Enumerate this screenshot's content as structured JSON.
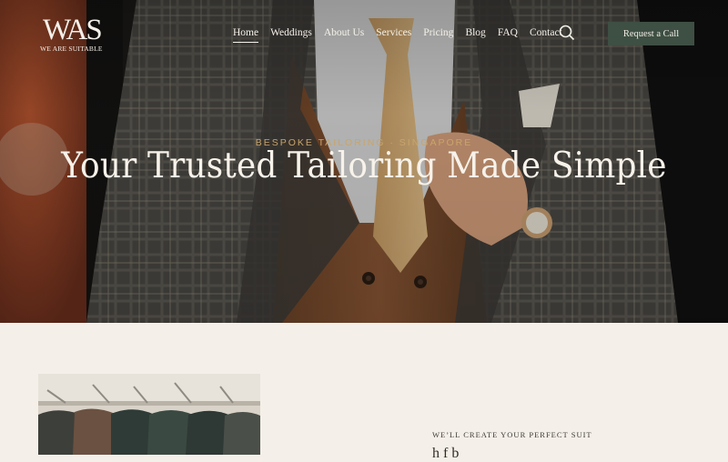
{
  "brand": {
    "mark": "WAS",
    "tagline": "WE ARE SUITABLE"
  },
  "nav": {
    "items": [
      {
        "label": "Home",
        "active": true
      },
      {
        "label": "Weddings"
      },
      {
        "label": "About Us"
      },
      {
        "label": "Services"
      },
      {
        "label": "Pricing"
      },
      {
        "label": "Blog"
      },
      {
        "label": "FAQ"
      },
      {
        "label": "Contact"
      }
    ],
    "search_icon": "search-icon",
    "cta_label": "Request a Call"
  },
  "hero": {
    "eyebrow": "BESPOKE TAILORING · SINGAPORE",
    "headline": "Your Trusted Tailoring Made Simple",
    "image": "man-in-checked-suit-jacket-waistcoat-tie"
  },
  "section": {
    "image": "suits-on-clothing-rack",
    "kicker": "WE’LL CREATE YOUR PERFECT SUIT",
    "teaser": "h         f      b"
  },
  "colors": {
    "accent_gold": "#c9a46b",
    "cta_green": "#3e4f43",
    "page_bg": "#f4efe8"
  }
}
